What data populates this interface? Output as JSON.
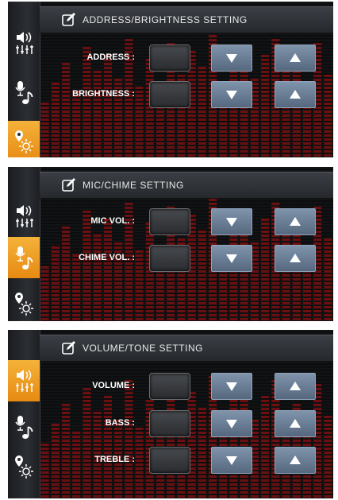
{
  "panels": [
    {
      "title": "ADDRESS/BRIGHTNESS SETTING",
      "active_tab": "brightness",
      "rows": [
        {
          "label": "ADDRESS :",
          "value": ""
        },
        {
          "label": "BRIGHTNESS :",
          "value": ""
        }
      ]
    },
    {
      "title": "MIC/CHIME SETTING",
      "active_tab": "mic",
      "rows": [
        {
          "label": "MIC VOL. :",
          "value": ""
        },
        {
          "label": "CHIME VOL. :",
          "value": ""
        }
      ]
    },
    {
      "title": "VOLUME/TONE SETTING",
      "active_tab": "volume",
      "rows": [
        {
          "label": "VOLUME :",
          "value": ""
        },
        {
          "label": "BASS :",
          "value": ""
        },
        {
          "label": "TREBLE :",
          "value": ""
        }
      ]
    }
  ],
  "icons": {
    "tab_volume": "speaker-equalizer-icon",
    "tab_mic": "microphone-note-icon",
    "tab_brightness": "location-sun-icon",
    "header": "edit-icon",
    "down": "down-triangle-icon",
    "up": "up-triangle-icon"
  },
  "colors": {
    "active_tab": "#f0a125",
    "button": "#6a7f97",
    "eq_bar": "#6b0f10",
    "background": "#0d0e0f"
  }
}
